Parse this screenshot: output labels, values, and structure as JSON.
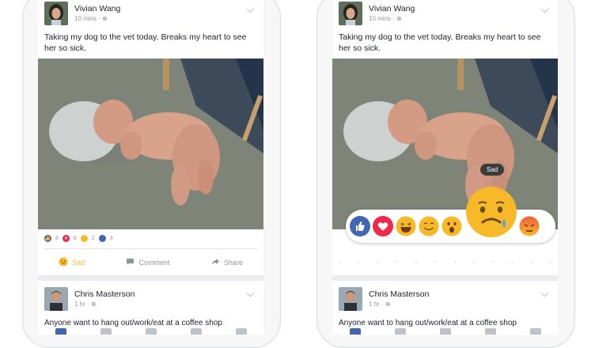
{
  "left_phone": {
    "post": {
      "author": "Vivian Wang",
      "time": "10 mins",
      "text": "Taking my dog to the vet today. Breaks my heart to see her so sick.",
      "reaction_counts": [
        "8",
        "8",
        "2",
        "3"
      ]
    },
    "actions": {
      "sad": "Sad",
      "comment": "Comment",
      "share": "Share"
    },
    "next_post": {
      "author": "Chris Masterson",
      "time": "1 hr",
      "snippet": "Anyone want to hang out/work/eat at a coffee shop"
    }
  },
  "right_phone": {
    "post": {
      "author": "Vivian Wang",
      "time": "10 mins",
      "text": "Taking my dog to the vet today. Breaks my heart to see her so sick."
    },
    "tooltip": "Sad",
    "reactions": [
      "like-icon",
      "love-icon",
      "haha-icon",
      "yay-icon",
      "wow-icon",
      "sad-icon",
      "angry-icon"
    ],
    "next_post": {
      "author": "Chris Masterson",
      "time": "1 hr",
      "snippet": "Anyone want to hang out/work/eat at a coffee shop"
    }
  },
  "colors": {
    "facebook_blue": "#4267b2",
    "love_red": "#f0284a",
    "reaction_yellow": "#f7b928",
    "angry_orange": "#f25f3a"
  }
}
